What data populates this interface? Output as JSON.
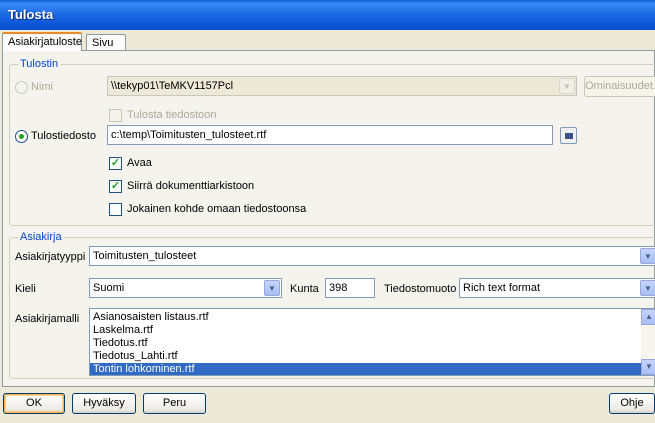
{
  "window": {
    "title": "Tulosta"
  },
  "tabs": [
    {
      "label": "Asiakirjatuloste",
      "active": true
    },
    {
      "label": "Sivu",
      "active": false
    }
  ],
  "printer_group": {
    "legend": "Tulostin",
    "name_label": "Nimi",
    "printer_value": "\\\\tekyp01\\TeMKV1157Pcl",
    "properties_button": "Ominaisuudet...",
    "print_to_file_label": "Tulosta tiedostoon",
    "output_file_label": "Tulostiedosto",
    "output_file_value": "c:\\temp\\Toimitusten_tulosteet.rtf",
    "open_label": "Avaa",
    "open_checked": true,
    "archive_label": "Siirrä dokumenttiarkistoon",
    "archive_checked": true,
    "each_item_label": "Jokainen kohde omaan tiedostoonsa",
    "each_item_checked": false,
    "selected_destination": "Tulostiedosto"
  },
  "document_group": {
    "legend": "Asiakirja",
    "type_label": "Asiakirjatyyppi",
    "type_value": "Toimitusten_tulosteet",
    "language_label": "Kieli",
    "language_value": "Suomi",
    "municipality_label": "Kunta",
    "municipality_value": "398",
    "format_label": "Tiedostomuoto",
    "format_value": "Rich text format",
    "template_label": "Asiakirjamalli",
    "templates": [
      "Asianosaisten listaus.rtf",
      "Laskelma.rtf",
      "Tiedotus.rtf",
      "Tiedotus_Lahti.rtf",
      "Tontin lohkominen.rtf"
    ],
    "selected_template": "Tontin lohkominen.rtf"
  },
  "buttons": {
    "ok": "OK",
    "accept": "Hyväksy",
    "cancel": "Peru",
    "help": "Ohje"
  },
  "colors": {
    "titlebar": "#0c4fc9",
    "group_legend": "#0046d5",
    "selection": "#316ac5",
    "check": "#21a121"
  }
}
